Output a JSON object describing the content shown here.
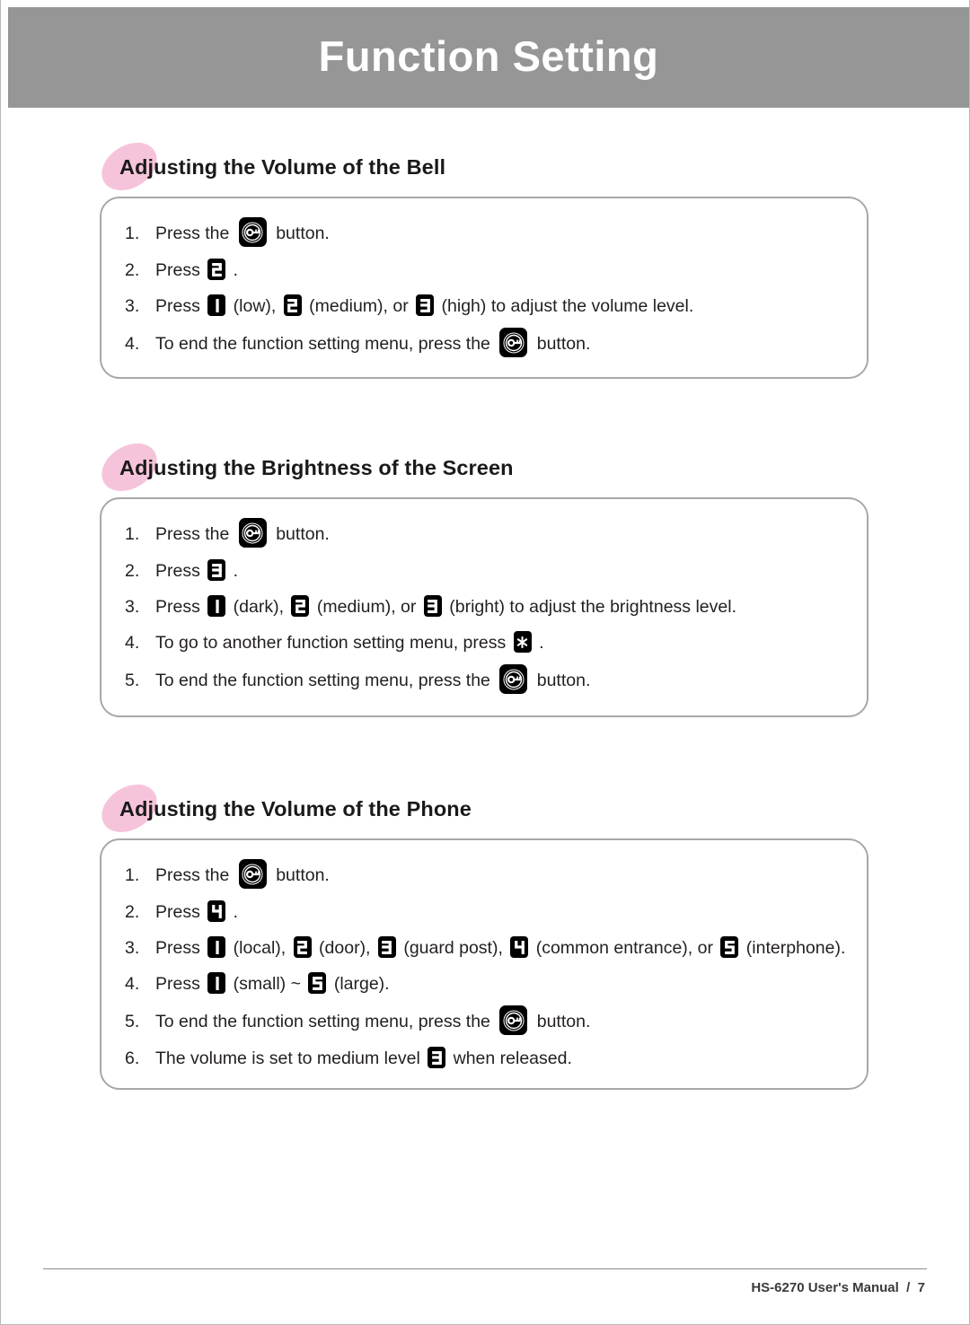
{
  "header": {
    "title": "Function Setting"
  },
  "icons": {
    "call_key": "call-key-icon",
    "key_1": "keypad-1-icon",
    "key_2": "keypad-2-icon",
    "key_3": "keypad-3-icon",
    "key_4": "keypad-4-icon",
    "key_5": "keypad-5-icon",
    "key_star": "keypad-star-icon"
  },
  "colors": {
    "banner": "#969696",
    "heading_blob": "#f6c4da",
    "box_border": "#a8a8a8",
    "text": "#231f20",
    "keycap": "#000000"
  },
  "sections": [
    {
      "heading": "Adjusting the Volume of the Bell",
      "steps": [
        {
          "num": "1.",
          "parts": [
            {
              "type": "text",
              "value": "Press the "
            },
            {
              "type": "key",
              "value": "call"
            },
            {
              "type": "text",
              "value": " button."
            }
          ]
        },
        {
          "num": "2.",
          "parts": [
            {
              "type": "text",
              "value": "Press "
            },
            {
              "type": "key",
              "value": "2"
            },
            {
              "type": "text",
              "value": " ."
            }
          ]
        },
        {
          "num": "3.",
          "parts": [
            {
              "type": "text",
              "value": "Press "
            },
            {
              "type": "key",
              "value": "1"
            },
            {
              "type": "text",
              "value": " (low), "
            },
            {
              "type": "key",
              "value": "2"
            },
            {
              "type": "text",
              "value": " (medium), or "
            },
            {
              "type": "key",
              "value": "3"
            },
            {
              "type": "text",
              "value": " (high) to adjust the volume level."
            }
          ]
        },
        {
          "num": "4.",
          "parts": [
            {
              "type": "text",
              "value": "To end the function setting menu, press the "
            },
            {
              "type": "key",
              "value": "call"
            },
            {
              "type": "text",
              "value": " button."
            }
          ]
        }
      ]
    },
    {
      "heading": "Adjusting the Brightness of the Screen",
      "steps": [
        {
          "num": "1.",
          "parts": [
            {
              "type": "text",
              "value": "Press the "
            },
            {
              "type": "key",
              "value": "call"
            },
            {
              "type": "text",
              "value": " button."
            }
          ]
        },
        {
          "num": "2.",
          "parts": [
            {
              "type": "text",
              "value": "Press "
            },
            {
              "type": "key",
              "value": "3"
            },
            {
              "type": "text",
              "value": " ."
            }
          ]
        },
        {
          "num": "3.",
          "parts": [
            {
              "type": "text",
              "value": "Press "
            },
            {
              "type": "key",
              "value": "1"
            },
            {
              "type": "text",
              "value": " (dark), "
            },
            {
              "type": "key",
              "value": "2"
            },
            {
              "type": "text",
              "value": " (medium), or "
            },
            {
              "type": "key",
              "value": "3"
            },
            {
              "type": "text",
              "value": " (bright) to adjust the brightness level."
            }
          ]
        },
        {
          "num": "4.",
          "parts": [
            {
              "type": "text",
              "value": "To go to another function setting menu, press "
            },
            {
              "type": "key",
              "value": "star"
            },
            {
              "type": "text",
              "value": " ."
            }
          ]
        },
        {
          "num": "5.",
          "parts": [
            {
              "type": "text",
              "value": "To end the function setting menu, press the "
            },
            {
              "type": "key",
              "value": "call"
            },
            {
              "type": "text",
              "value": " button."
            }
          ]
        }
      ]
    },
    {
      "heading": "Adjusting the Volume of the Phone",
      "steps": [
        {
          "num": "1.",
          "parts": [
            {
              "type": "text",
              "value": "Press the "
            },
            {
              "type": "key",
              "value": "call"
            },
            {
              "type": "text",
              "value": " button."
            }
          ]
        },
        {
          "num": "2.",
          "parts": [
            {
              "type": "text",
              "value": "Press "
            },
            {
              "type": "key",
              "value": "4"
            },
            {
              "type": "text",
              "value": " ."
            }
          ]
        },
        {
          "num": "3.",
          "parts": [
            {
              "type": "text",
              "value": "Press "
            },
            {
              "type": "key",
              "value": "1"
            },
            {
              "type": "text",
              "value": " (local), "
            },
            {
              "type": "key",
              "value": "2"
            },
            {
              "type": "text",
              "value": " (door), "
            },
            {
              "type": "key",
              "value": "3"
            },
            {
              "type": "text",
              "value": " (guard post), "
            },
            {
              "type": "key",
              "value": "4"
            },
            {
              "type": "text",
              "value": " (common entrance), or "
            },
            {
              "type": "key",
              "value": "5"
            },
            {
              "type": "text",
              "value": " (interphone)."
            }
          ]
        },
        {
          "num": "4.",
          "parts": [
            {
              "type": "text",
              "value": "Press "
            },
            {
              "type": "key",
              "value": "1"
            },
            {
              "type": "text",
              "value": " (small) ~ "
            },
            {
              "type": "key",
              "value": "5"
            },
            {
              "type": "text",
              "value": " (large)."
            }
          ]
        },
        {
          "num": "5.",
          "parts": [
            {
              "type": "text",
              "value": "To end the function setting menu, press the "
            },
            {
              "type": "key",
              "value": "call"
            },
            {
              "type": "text",
              "value": " button."
            }
          ]
        },
        {
          "num": "6.",
          "parts": [
            {
              "type": "text",
              "value": "The volume is set to medium level "
            },
            {
              "type": "key",
              "value": "3"
            },
            {
              "type": "text",
              "value": " when released."
            }
          ]
        }
      ]
    }
  ],
  "footer": {
    "text": "HS-6270 User's Manual  /  7"
  }
}
